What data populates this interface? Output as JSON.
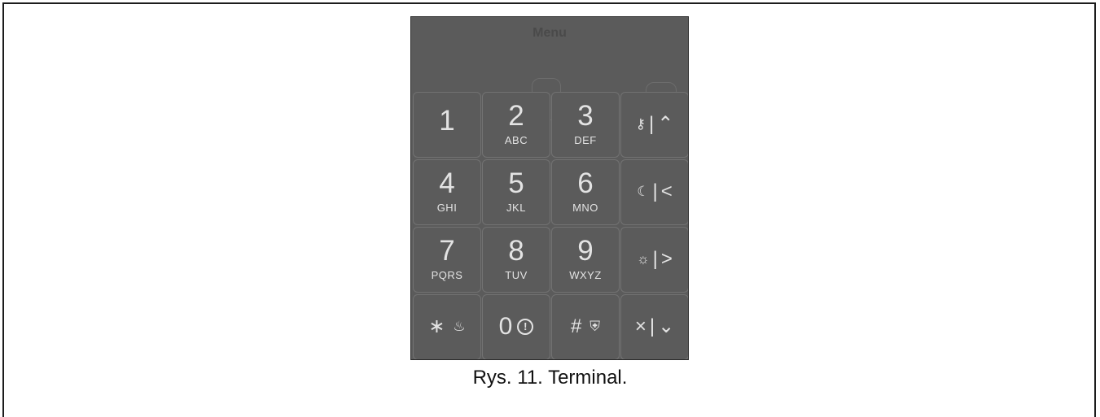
{
  "terminal": {
    "menu_title": "Menu",
    "keys": [
      {
        "digit": "1",
        "letters": ""
      },
      {
        "digit": "2",
        "letters": "ABC"
      },
      {
        "digit": "3",
        "letters": "DEF"
      },
      {
        "digit": "4",
        "letters": "GHI"
      },
      {
        "digit": "5",
        "letters": "JKL"
      },
      {
        "digit": "6",
        "letters": "MNO"
      },
      {
        "digit": "7",
        "letters": "PQRS"
      },
      {
        "digit": "8",
        "letters": "TUV"
      },
      {
        "digit": "9",
        "letters": "WXYZ"
      }
    ],
    "function_keys": {
      "arm_up": {
        "icon": "key-icon",
        "symbol": "⚷",
        "sep": "|",
        "arrow": "⌃"
      },
      "night_left": {
        "icon": "moon-icon",
        "symbol": "☾",
        "sep": "|",
        "arrow": "<"
      },
      "day_right": {
        "icon": "sun-icon",
        "symbol": "☼",
        "sep": "|",
        "arrow": ">"
      },
      "clear_down": {
        "icon": "close-icon",
        "symbol": "×",
        "sep": "|",
        "arrow": "⌄"
      }
    },
    "bottom_keys": {
      "star": {
        "symbol": "∗",
        "icon": "fire-icon",
        "icon_glyph": "♨"
      },
      "zero": {
        "digit": "0",
        "icon": "alarm-icon",
        "icon_glyph": "!"
      },
      "hash": {
        "symbol": "#",
        "icon": "police-icon",
        "icon_glyph": "⛨"
      }
    }
  },
  "caption": "Rys. 11. Terminal."
}
